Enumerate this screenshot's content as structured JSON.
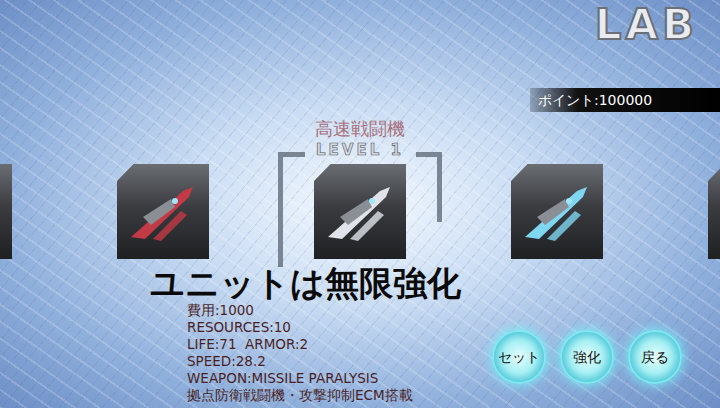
{
  "logo": "LAB",
  "points": "ポイント:100000",
  "unit": {
    "name": "高速戦闘機",
    "level": "LEVEL 1"
  },
  "units": [
    {
      "selected": false
    },
    {
      "selected": false
    },
    {
      "selected": true
    },
    {
      "selected": false
    },
    {
      "selected": false
    }
  ],
  "caption": "ユニットは無限強化",
  "stats": [
    "費用:1000",
    "RESOURCES:10",
    "LIFE:71  ARMOR:2",
    "SPEED:28.2",
    "WEAPON:MISSILE PARALYSIS",
    "拠点防衛戦闘機・攻撃抑制ECM搭載"
  ],
  "buttons": [
    "セット",
    "強化",
    "戻る"
  ]
}
